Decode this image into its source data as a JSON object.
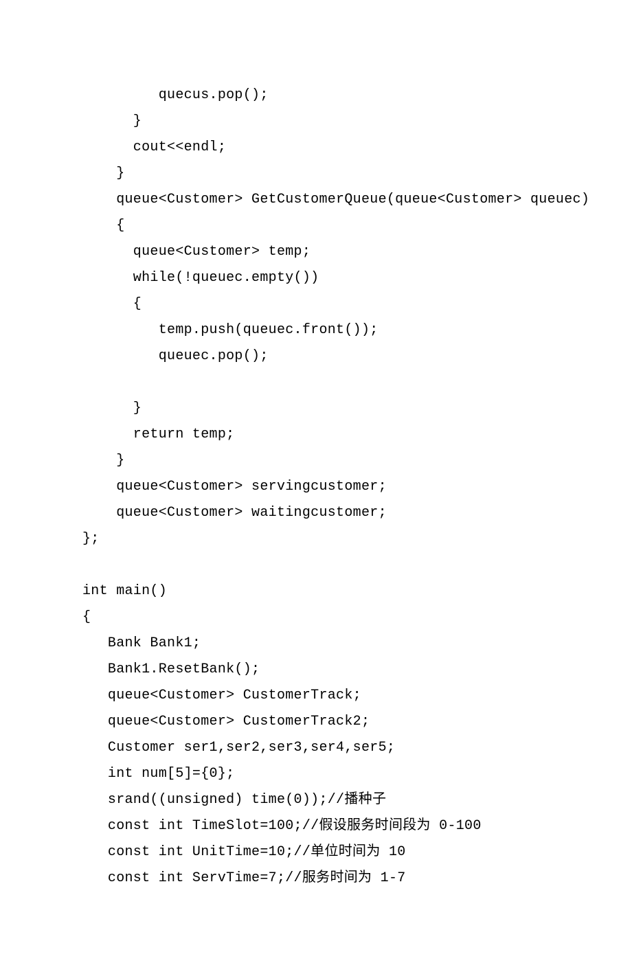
{
  "lines": [
    "         quecus.pop();",
    "      }",
    "      cout<<endl;",
    "    }",
    "    queue<Customer> GetCustomerQueue(queue<Customer> queuec)",
    "    {",
    "      queue<Customer> temp;",
    "      while(!queuec.empty())",
    "      {",
    "         temp.push(queuec.front());",
    "         queuec.pop();",
    "",
    "      }",
    "      return temp;",
    "    }",
    "    queue<Customer> servingcustomer;",
    "    queue<Customer> waitingcustomer;",
    "};",
    "",
    "int main()",
    "{",
    "   Bank Bank1;",
    "   Bank1.ResetBank();",
    "   queue<Customer> CustomerTrack;",
    "   queue<Customer> CustomerTrack2;",
    "   Customer ser1,ser2,ser3,ser4,ser5;",
    "   int num[5]={0};",
    "   srand((unsigned) time(0));//播种子",
    "   const int TimeSlot=100;//假设服务时间段为 0-100",
    "   const int UnitTime=10;//单位时间为 10",
    "   const int ServTime=7;//服务时间为 1-7"
  ]
}
